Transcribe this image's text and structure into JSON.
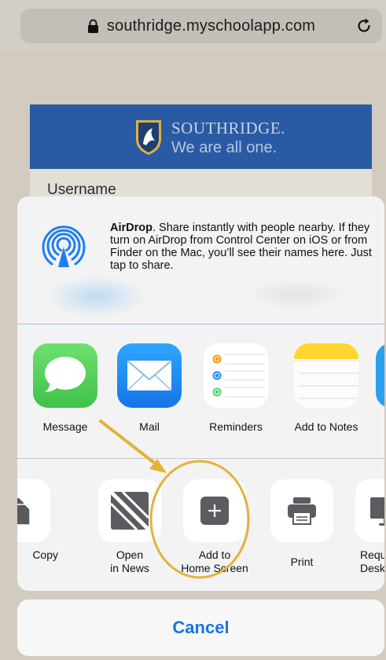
{
  "browser": {
    "url": "southridge.myschoolapp.com"
  },
  "page": {
    "school_name": "SOUTHRIDGE.",
    "school_tagline": "We are all one.",
    "username_label": "Username"
  },
  "share_sheet": {
    "airdrop": {
      "title": "AirDrop",
      "description": ". Share instantly with people nearby. If they turn on AirDrop from Control Center on iOS or from Finder on the Mac, you’ll see their names here. Just tap to share."
    },
    "apps": [
      {
        "label": "Message",
        "icon": "messages-icon",
        "color": "#4cd964"
      },
      {
        "label": "Mail",
        "icon": "mail-icon",
        "color": "#1d8df2"
      },
      {
        "label": "Reminders",
        "icon": "reminders-icon",
        "color": "#ffffff"
      },
      {
        "label": "Add to Notes",
        "icon": "notes-icon",
        "color": "#ffd52e"
      }
    ],
    "actions": [
      {
        "label": "Copy",
        "icon": "copy-icon"
      },
      {
        "label_line1": "Open",
        "label_line2": "in News",
        "icon": "news-icon"
      },
      {
        "label_line1": "Add to",
        "label_line2": "Home Screen",
        "icon": "add-square-icon"
      },
      {
        "label": "Print",
        "icon": "printer-icon"
      },
      {
        "label_line1": "Request",
        "label_line2": "Desktop Site",
        "icon": "desktop-icon"
      }
    ],
    "cancel_label": "Cancel"
  },
  "annotation": {
    "highlight_color": "#e2b23a",
    "target": "Add to Home Screen"
  }
}
